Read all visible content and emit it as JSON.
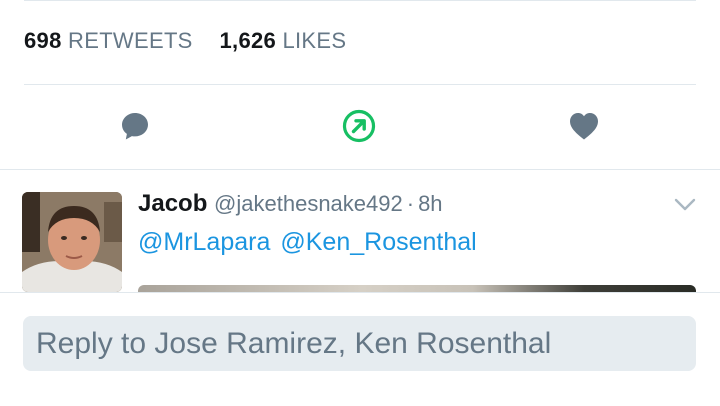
{
  "stats": {
    "retweets_count": "698",
    "retweets_label": "RETWEETS",
    "likes_count": "1,626",
    "likes_label": "LIKES"
  },
  "actions": [
    {
      "icon": "reply-icon",
      "color": "#657786"
    },
    {
      "icon": "retweet-icon",
      "color": "#17bf63",
      "state": "active"
    },
    {
      "icon": "heart-icon",
      "color": "#657786"
    }
  ],
  "reply_tweet": {
    "author_name": "Jacob",
    "author_handle": "@jakethesnake492",
    "separator": "·",
    "time": "8h",
    "mentions": [
      "@MrLapara",
      "@Ken_Rosenthal"
    ]
  },
  "composer": {
    "placeholder": "Reply to Jose Ramirez, Ken Rosenthal"
  },
  "colors": {
    "link": "#1b95e0",
    "muted": "#657786",
    "retweet_active": "#17bf63",
    "divider": "#e1e8ed",
    "composer_bg": "#e6ecf0"
  }
}
